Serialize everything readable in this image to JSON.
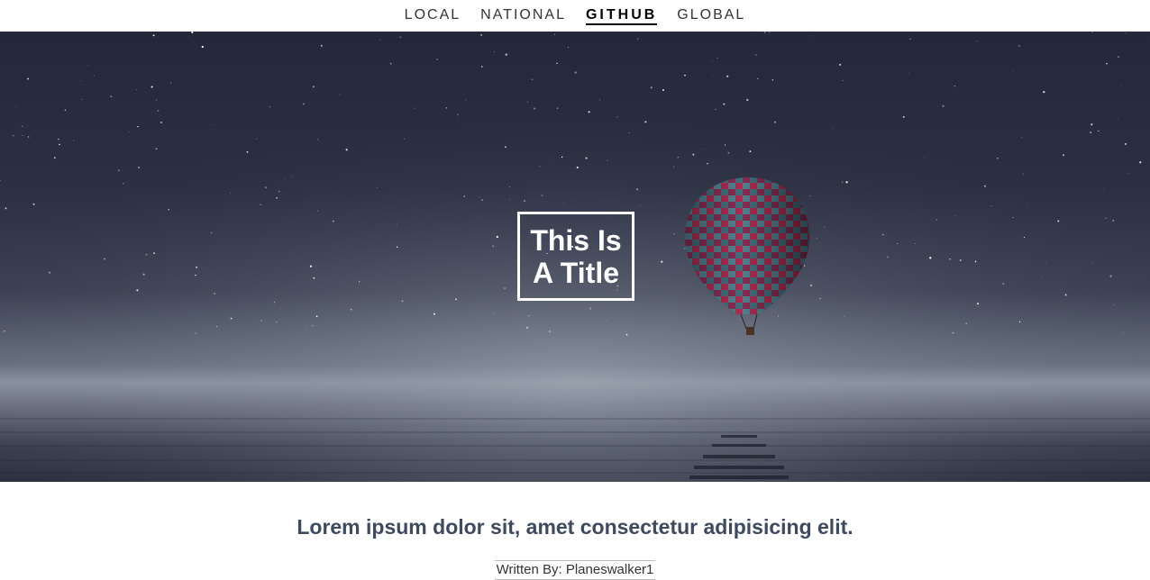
{
  "nav": {
    "items": [
      {
        "label": "LOCAL",
        "active": false
      },
      {
        "label": "NATIONAL",
        "active": false
      },
      {
        "label": "GITHUB",
        "active": true
      },
      {
        "label": "GLOBAL",
        "active": false
      }
    ]
  },
  "hero": {
    "title_line1": "This Is",
    "title_line2": "A Title"
  },
  "article": {
    "headline": "Lorem ipsum dolor sit, amet consectetur adipisicing elit.",
    "byline": "Written By: Planeswalker1"
  }
}
